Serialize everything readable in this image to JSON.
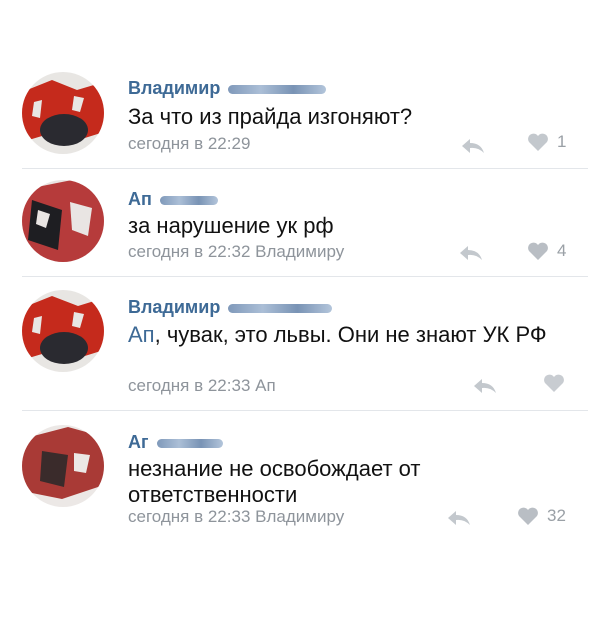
{
  "comments": [
    {
      "author": "Владимир",
      "text": "За что из прайда изгоняют?",
      "text_mention": "",
      "time": "сегодня в 22:29",
      "reply_to": "",
      "likes": "1",
      "avatar_palette": [
        "#c52a1c",
        "#2a2a30",
        "#e8e6e3"
      ]
    },
    {
      "author": "Ап",
      "text": "за нарушение ук рф",
      "text_mention": "",
      "time": "сегодня в 22:32",
      "reply_to": "Владимиру",
      "likes": "4",
      "avatar_palette": [
        "#b63b3b",
        "#1e1e22",
        "#e9e5e3"
      ]
    },
    {
      "author": "Владимир",
      "text_mention": "Ап",
      "text": ", чувак, это львы. Они не знают УК РФ",
      "time": "сегодня в 22:33",
      "reply_to": "Ап",
      "likes": "",
      "avatar_palette": [
        "#c52a1c",
        "#2a2a30",
        "#e8e6e3"
      ]
    },
    {
      "author": "Аг",
      "text": "незнание не освобождает от ответственности",
      "text_mention": "",
      "time": "сегодня в 22:33",
      "reply_to": "Владимиру",
      "likes": "32",
      "avatar_palette": [
        "#a93a36",
        "#3a2b2b",
        "#ece8e6"
      ]
    }
  ],
  "icons": {
    "reply": "reply-arrow-icon",
    "like": "heart-icon"
  },
  "colors": {
    "author": "#3e6a96",
    "meta": "#8e949b",
    "divider": "#e3e6ea"
  }
}
